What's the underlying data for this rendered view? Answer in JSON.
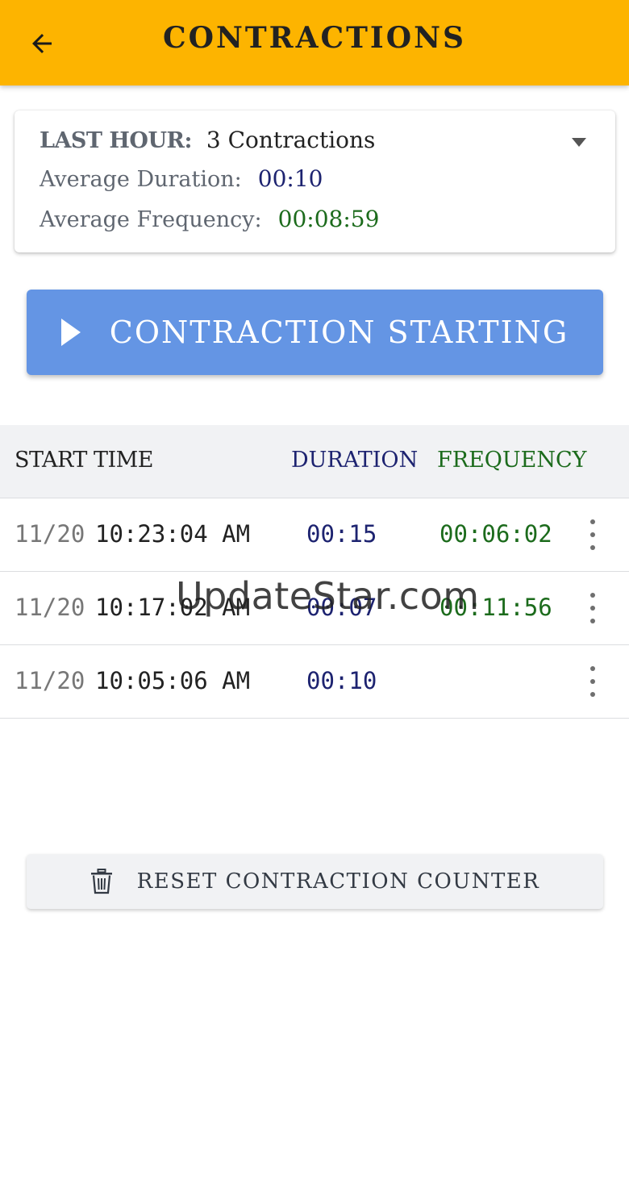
{
  "header": {
    "title": "CONTRACTIONS",
    "back_icon": "arrow-left-icon",
    "background": "#fdb400"
  },
  "summary": {
    "last_hour_label": "LAST HOUR:",
    "last_hour_value": "3 Contractions",
    "avg_duration_label": "Average Duration:",
    "avg_duration_value": "00:10",
    "avg_frequency_label": "Average Frequency:",
    "avg_frequency_value": "00:08:59",
    "dropdown_icon": "caret-down-icon"
  },
  "start_button": {
    "label": "CONTRACTION STARTING",
    "icon": "play-icon",
    "color": "#6495e4"
  },
  "table": {
    "columns": {
      "start_time": "START TIME",
      "duration": "DURATION",
      "frequency": "FREQUENCY"
    },
    "rows": [
      {
        "date": "11/20",
        "time": "10:23:04 AM",
        "duration": "00:15",
        "frequency": "00:06:02"
      },
      {
        "date": "11/20",
        "time": "10:17:02 AM",
        "duration": "00:07",
        "frequency": "00:11:56"
      },
      {
        "date": "11/20",
        "time": "10:05:06 AM",
        "duration": "00:10",
        "frequency": ""
      }
    ]
  },
  "reset_button": {
    "label": "RESET CONTRACTION COUNTER",
    "icon": "trash-icon"
  },
  "watermark": "UpdateStar.com",
  "colors": {
    "duration": "#1d2370",
    "frequency": "#1c6b1c"
  }
}
